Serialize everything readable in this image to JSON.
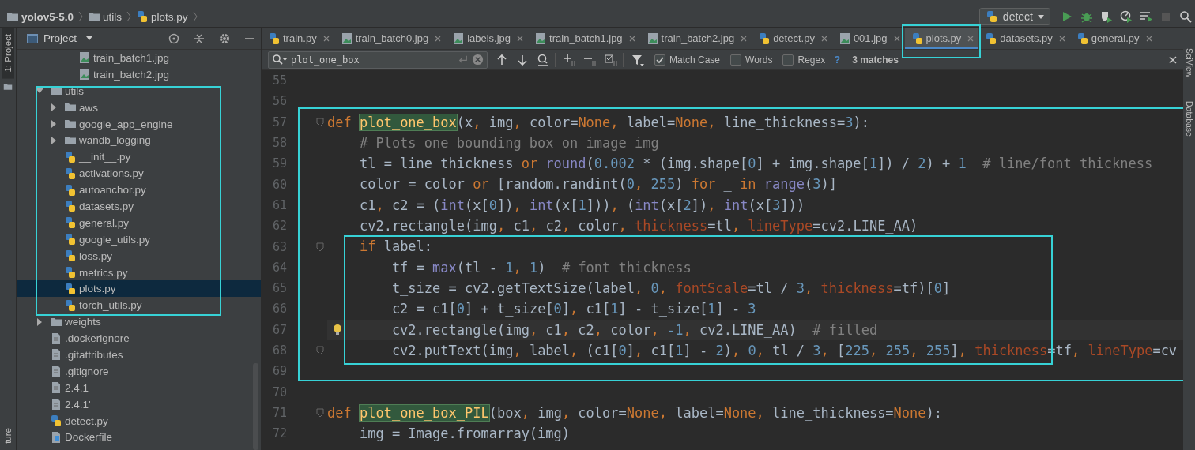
{
  "breadcrumb": [
    {
      "label": "yolov5-5.0",
      "kind": "folder"
    },
    {
      "label": "utils",
      "kind": "folder"
    },
    {
      "label": "plots.py",
      "kind": "python"
    }
  ],
  "run_config": {
    "label": "detect"
  },
  "tool_strip": {
    "left": [
      {
        "label": "1: Project",
        "selected": true
      }
    ],
    "left_bottom": "ture",
    "right": [
      {
        "label": "SciView"
      },
      {
        "label": "Database"
      }
    ]
  },
  "project_panel": {
    "title": "Project",
    "tree": {
      "above": [
        {
          "label": "train_batch1.jpg",
          "kind": "image",
          "selected": false
        },
        {
          "label": "train_batch2.jpg",
          "kind": "image",
          "selected": false
        }
      ],
      "items": [
        {
          "label": "utils",
          "kind": "folder",
          "expanded": true,
          "framed": true,
          "selected": false,
          "children": [
            {
              "label": "aws",
              "kind": "folder",
              "expanded": false,
              "selected": false
            },
            {
              "label": "google_app_engine",
              "kind": "folder",
              "expanded": false,
              "selected": false
            },
            {
              "label": "wandb_logging",
              "kind": "folder",
              "expanded": false,
              "selected": false
            },
            {
              "label": "__init__.py",
              "kind": "python",
              "selected": false
            },
            {
              "label": "activations.py",
              "kind": "python",
              "selected": false
            },
            {
              "label": "autoanchor.py",
              "kind": "python",
              "selected": false
            },
            {
              "label": "datasets.py",
              "kind": "python",
              "selected": false
            },
            {
              "label": "general.py",
              "kind": "python",
              "selected": false
            },
            {
              "label": "google_utils.py",
              "kind": "python",
              "selected": false
            },
            {
              "label": "loss.py",
              "kind": "python",
              "selected": false
            },
            {
              "label": "metrics.py",
              "kind": "python",
              "selected": false
            },
            {
              "label": "plots.py",
              "kind": "python",
              "selected": true
            },
            {
              "label": "torch_utils.py",
              "kind": "python",
              "selected": false
            }
          ]
        },
        {
          "label": "weights",
          "kind": "folder",
          "expanded": false,
          "selected": false
        },
        {
          "label": ".dockerignore",
          "kind": "text",
          "selected": false
        },
        {
          "label": ".gitattributes",
          "kind": "text",
          "selected": false
        },
        {
          "label": ".gitignore",
          "kind": "text",
          "selected": false
        },
        {
          "label": "2.4.1",
          "kind": "text",
          "selected": false
        },
        {
          "label": "2.4.1'",
          "kind": "text",
          "selected": false
        },
        {
          "label": "detect.py",
          "kind": "python",
          "selected": false
        },
        {
          "label": "Dockerfile",
          "kind": "docker",
          "selected": false
        }
      ]
    }
  },
  "tabs": [
    {
      "label": "train.py",
      "kind": "python",
      "selected": false
    },
    {
      "label": "train_batch0.jpg",
      "kind": "image",
      "selected": false
    },
    {
      "label": "labels.jpg",
      "kind": "image",
      "selected": false
    },
    {
      "label": "train_batch1.jpg",
      "kind": "image",
      "selected": false
    },
    {
      "label": "train_batch2.jpg",
      "kind": "image",
      "selected": false
    },
    {
      "label": "detect.py",
      "kind": "python",
      "selected": false
    },
    {
      "label": "001.jpg",
      "kind": "image",
      "selected": false
    },
    {
      "label": "plots.py",
      "kind": "python",
      "selected": true,
      "framed": true
    },
    {
      "label": "datasets.py",
      "kind": "python",
      "selected": false
    },
    {
      "label": "general.py",
      "kind": "python",
      "selected": false
    }
  ],
  "search": {
    "value": "plot_one_box",
    "options": [
      {
        "label": "Match Case",
        "checked": true
      },
      {
        "label": "Words",
        "checked": false
      },
      {
        "label": "Regex",
        "checked": false
      }
    ],
    "help": "?",
    "result": "3 matches"
  },
  "code": {
    "blocks": [
      {
        "lines": [
          {
            "kind": "line",
            "number": "55"
          },
          {
            "kind": "line",
            "number": "56"
          }
        ]
      },
      {
        "framed": true,
        "lines": [
          {
            "kind": "line",
            "number": "57",
            "fold": true,
            "tokens": [
              {
                "kind": "k",
                "text": "def "
              },
              {
                "kind": "m",
                "text": "plot_one_box"
              },
              {
                "kind": "p",
                "text": "(x"
              },
              {
                "kind": "k",
                "text": ", "
              },
              {
                "kind": "p",
                "text": "img"
              },
              {
                "kind": "k",
                "text": ", "
              },
              {
                "kind": "p",
                "text": "color="
              },
              {
                "kind": "k",
                "text": "None"
              },
              {
                "kind": "k",
                "text": ", "
              },
              {
                "kind": "p",
                "text": "label="
              },
              {
                "kind": "k",
                "text": "None"
              },
              {
                "kind": "k",
                "text": ", "
              },
              {
                "kind": "p",
                "text": "line_thickness="
              },
              {
                "kind": "n",
                "text": "3"
              },
              {
                "kind": "p",
                "text": "):"
              }
            ]
          },
          {
            "kind": "line",
            "number": "58",
            "tokens": [
              {
                "kind": "c",
                "text": "    # Plots one bounding box on image img"
              }
            ]
          },
          {
            "kind": "line",
            "number": "59",
            "tokens": [
              {
                "kind": "p",
                "text": "    tl = line_thickness "
              },
              {
                "kind": "k",
                "text": "or "
              },
              {
                "kind": "b",
                "text": "round"
              },
              {
                "kind": "p",
                "text": "("
              },
              {
                "kind": "n",
                "text": "0.002"
              },
              {
                "kind": "p",
                "text": " * (img.shape["
              },
              {
                "kind": "n",
                "text": "0"
              },
              {
                "kind": "p",
                "text": "] + img.shape["
              },
              {
                "kind": "n",
                "text": "1"
              },
              {
                "kind": "p",
                "text": "]) / "
              },
              {
                "kind": "n",
                "text": "2"
              },
              {
                "kind": "p",
                "text": ") + "
              },
              {
                "kind": "n",
                "text": "1"
              },
              {
                "kind": "c",
                "text": "  # line/font thickness"
              }
            ]
          },
          {
            "kind": "line",
            "number": "60",
            "tokens": [
              {
                "kind": "p",
                "text": "    color = color "
              },
              {
                "kind": "k",
                "text": "or "
              },
              {
                "kind": "p",
                "text": "[random.randint("
              },
              {
                "kind": "n",
                "text": "0"
              },
              {
                "kind": "k",
                "text": ", "
              },
              {
                "kind": "n",
                "text": "255"
              },
              {
                "kind": "p",
                "text": ") "
              },
              {
                "kind": "k",
                "text": "for "
              },
              {
                "kind": "p",
                "text": "_ "
              },
              {
                "kind": "k",
                "text": "in "
              },
              {
                "kind": "b",
                "text": "range"
              },
              {
                "kind": "p",
                "text": "("
              },
              {
                "kind": "n",
                "text": "3"
              },
              {
                "kind": "p",
                "text": ")]"
              }
            ]
          },
          {
            "kind": "line",
            "number": "61",
            "tokens": [
              {
                "kind": "p",
                "text": "    c1"
              },
              {
                "kind": "k",
                "text": ", "
              },
              {
                "kind": "p",
                "text": "c2 = ("
              },
              {
                "kind": "b",
                "text": "int"
              },
              {
                "kind": "p",
                "text": "(x["
              },
              {
                "kind": "n",
                "text": "0"
              },
              {
                "kind": "p",
                "text": "])"
              },
              {
                "kind": "k",
                "text": ", "
              },
              {
                "kind": "b",
                "text": "int"
              },
              {
                "kind": "p",
                "text": "(x["
              },
              {
                "kind": "n",
                "text": "1"
              },
              {
                "kind": "p",
                "text": "]))"
              },
              {
                "kind": "k",
                "text": ", "
              },
              {
                "kind": "p",
                "text": "("
              },
              {
                "kind": "b",
                "text": "int"
              },
              {
                "kind": "p",
                "text": "(x["
              },
              {
                "kind": "n",
                "text": "2"
              },
              {
                "kind": "p",
                "text": "])"
              },
              {
                "kind": "k",
                "text": ", "
              },
              {
                "kind": "b",
                "text": "int"
              },
              {
                "kind": "p",
                "text": "(x["
              },
              {
                "kind": "n",
                "text": "3"
              },
              {
                "kind": "p",
                "text": "]))"
              }
            ]
          },
          {
            "kind": "line",
            "number": "62",
            "tokens": [
              {
                "kind": "p",
                "text": "    cv2.rectangle(img"
              },
              {
                "kind": "k",
                "text": ", "
              },
              {
                "kind": "p",
                "text": "c1"
              },
              {
                "kind": "k",
                "text": ", "
              },
              {
                "kind": "p",
                "text": "c2"
              },
              {
                "kind": "k",
                "text": ", "
              },
              {
                "kind": "p",
                "text": "color"
              },
              {
                "kind": "k",
                "text": ", "
              },
              {
                "kind": "a",
                "text": "thickness"
              },
              {
                "kind": "p",
                "text": "=tl"
              },
              {
                "kind": "k",
                "text": ", "
              },
              {
                "kind": "a",
                "text": "lineType"
              },
              {
                "kind": "p",
                "text": "=cv2.LINE_AA)"
              }
            ]
          },
          {
            "kind": "block",
            "framed": true,
            "lines": [
              {
                "kind": "line",
                "number": "63",
                "fold": true,
                "tokens": [
                  {
                    "kind": "k",
                    "text": "    if "
                  },
                  {
                    "kind": "p",
                    "text": "label:"
                  }
                ]
              },
              {
                "kind": "line",
                "number": "64",
                "tokens": [
                  {
                    "kind": "p",
                    "text": "        tf = "
                  },
                  {
                    "kind": "b",
                    "text": "max"
                  },
                  {
                    "kind": "p",
                    "text": "(tl - "
                  },
                  {
                    "kind": "n",
                    "text": "1"
                  },
                  {
                    "kind": "k",
                    "text": ", "
                  },
                  {
                    "kind": "n",
                    "text": "1"
                  },
                  {
                    "kind": "p",
                    "text": ")"
                  },
                  {
                    "kind": "c",
                    "text": "  # font thickness"
                  }
                ]
              },
              {
                "kind": "line",
                "number": "65",
                "tokens": [
                  {
                    "kind": "p",
                    "text": "        t_size = cv2.getTextSize(label"
                  },
                  {
                    "kind": "k",
                    "text": ", "
                  },
                  {
                    "kind": "n",
                    "text": "0"
                  },
                  {
                    "kind": "k",
                    "text": ", "
                  },
                  {
                    "kind": "a",
                    "text": "fontScale"
                  },
                  {
                    "kind": "p",
                    "text": "=tl / "
                  },
                  {
                    "kind": "n",
                    "text": "3"
                  },
                  {
                    "kind": "k",
                    "text": ", "
                  },
                  {
                    "kind": "a",
                    "text": "thickness"
                  },
                  {
                    "kind": "p",
                    "text": "=tf)["
                  },
                  {
                    "kind": "n",
                    "text": "0"
                  },
                  {
                    "kind": "p",
                    "text": "]"
                  }
                ]
              },
              {
                "kind": "line",
                "number": "66",
                "tokens": [
                  {
                    "kind": "p",
                    "text": "        c2 = c1["
                  },
                  {
                    "kind": "n",
                    "text": "0"
                  },
                  {
                    "kind": "p",
                    "text": "] + t_size["
                  },
                  {
                    "kind": "n",
                    "text": "0"
                  },
                  {
                    "kind": "p",
                    "text": "]"
                  },
                  {
                    "kind": "k",
                    "text": ", "
                  },
                  {
                    "kind": "p",
                    "text": "c1["
                  },
                  {
                    "kind": "n",
                    "text": "1"
                  },
                  {
                    "kind": "p",
                    "text": "] - t_size["
                  },
                  {
                    "kind": "n",
                    "text": "1"
                  },
                  {
                    "kind": "p",
                    "text": "] - "
                  },
                  {
                    "kind": "n",
                    "text": "3"
                  }
                ]
              },
              {
                "kind": "line",
                "number": "67",
                "current": true,
                "bulb": true,
                "tokens": [
                  {
                    "kind": "p",
                    "text": "        cv2.rectangle(img"
                  },
                  {
                    "kind": "k",
                    "text": ", "
                  },
                  {
                    "kind": "p",
                    "text": "c1"
                  },
                  {
                    "kind": "k",
                    "text": ", "
                  },
                  {
                    "kind": "p",
                    "text": "c2"
                  },
                  {
                    "kind": "k",
                    "text": ", "
                  },
                  {
                    "kind": "p",
                    "text": "color"
                  },
                  {
                    "kind": "k",
                    "text": ", "
                  },
                  {
                    "kind": "n",
                    "text": "-1"
                  },
                  {
                    "kind": "k",
                    "text": ", "
                  },
                  {
                    "kind": "p",
                    "text": "cv2.LINE_AA)"
                  },
                  {
                    "kind": "c",
                    "text": "  # filled"
                  }
                ]
              },
              {
                "kind": "line",
                "number": "68",
                "fold": true,
                "tokens": [
                  {
                    "kind": "p",
                    "text": "        cv2.putText(img"
                  },
                  {
                    "kind": "k",
                    "text": ", "
                  },
                  {
                    "kind": "p",
                    "text": "label"
                  },
                  {
                    "kind": "k",
                    "text": ", "
                  },
                  {
                    "kind": "p",
                    "text": "(c1["
                  },
                  {
                    "kind": "n",
                    "text": "0"
                  },
                  {
                    "kind": "p",
                    "text": "]"
                  },
                  {
                    "kind": "k",
                    "text": ", "
                  },
                  {
                    "kind": "p",
                    "text": "c1["
                  },
                  {
                    "kind": "n",
                    "text": "1"
                  },
                  {
                    "kind": "p",
                    "text": "] - "
                  },
                  {
                    "kind": "n",
                    "text": "2"
                  },
                  {
                    "kind": "p",
                    "text": ")"
                  },
                  {
                    "kind": "k",
                    "text": ", "
                  },
                  {
                    "kind": "n",
                    "text": "0"
                  },
                  {
                    "kind": "k",
                    "text": ", "
                  },
                  {
                    "kind": "p",
                    "text": "tl / "
                  },
                  {
                    "kind": "n",
                    "text": "3"
                  },
                  {
                    "kind": "k",
                    "text": ", "
                  },
                  {
                    "kind": "p",
                    "text": "["
                  },
                  {
                    "kind": "n",
                    "text": "225"
                  },
                  {
                    "kind": "k",
                    "text": ", "
                  },
                  {
                    "kind": "n",
                    "text": "255"
                  },
                  {
                    "kind": "k",
                    "text": ", "
                  },
                  {
                    "kind": "n",
                    "text": "255"
                  },
                  {
                    "kind": "p",
                    "text": "]"
                  },
                  {
                    "kind": "k",
                    "text": ", "
                  },
                  {
                    "kind": "a",
                    "text": "thickness"
                  },
                  {
                    "kind": "p",
                    "text": "=tf"
                  },
                  {
                    "kind": "k",
                    "text": ", "
                  },
                  {
                    "kind": "a",
                    "text": "lineType"
                  },
                  {
                    "kind": "p",
                    "text": "=cv"
                  }
                ]
              }
            ]
          },
          {
            "kind": "line",
            "number": "69"
          }
        ]
      },
      {
        "lines": [
          {
            "kind": "line",
            "number": "70"
          },
          {
            "kind": "line",
            "number": "71",
            "fold": true,
            "tokens": [
              {
                "kind": "k",
                "text": "def "
              },
              {
                "kind": "m",
                "text": "plot_one_box_PIL"
              },
              {
                "kind": "p",
                "text": "(box"
              },
              {
                "kind": "k",
                "text": ", "
              },
              {
                "kind": "p",
                "text": "img"
              },
              {
                "kind": "k",
                "text": ", "
              },
              {
                "kind": "p",
                "text": "color="
              },
              {
                "kind": "k",
                "text": "None"
              },
              {
                "kind": "k",
                "text": ", "
              },
              {
                "kind": "p",
                "text": "label="
              },
              {
                "kind": "k",
                "text": "None"
              },
              {
                "kind": "k",
                "text": ", "
              },
              {
                "kind": "p",
                "text": "line_thickness="
              },
              {
                "kind": "k",
                "text": "None"
              },
              {
                "kind": "p",
                "text": "):"
              }
            ]
          },
          {
            "kind": "line",
            "number": "72",
            "tokens": [
              {
                "kind": "p",
                "text": "    img = Image.fromarray(img)"
              }
            ]
          }
        ]
      }
    ]
  }
}
